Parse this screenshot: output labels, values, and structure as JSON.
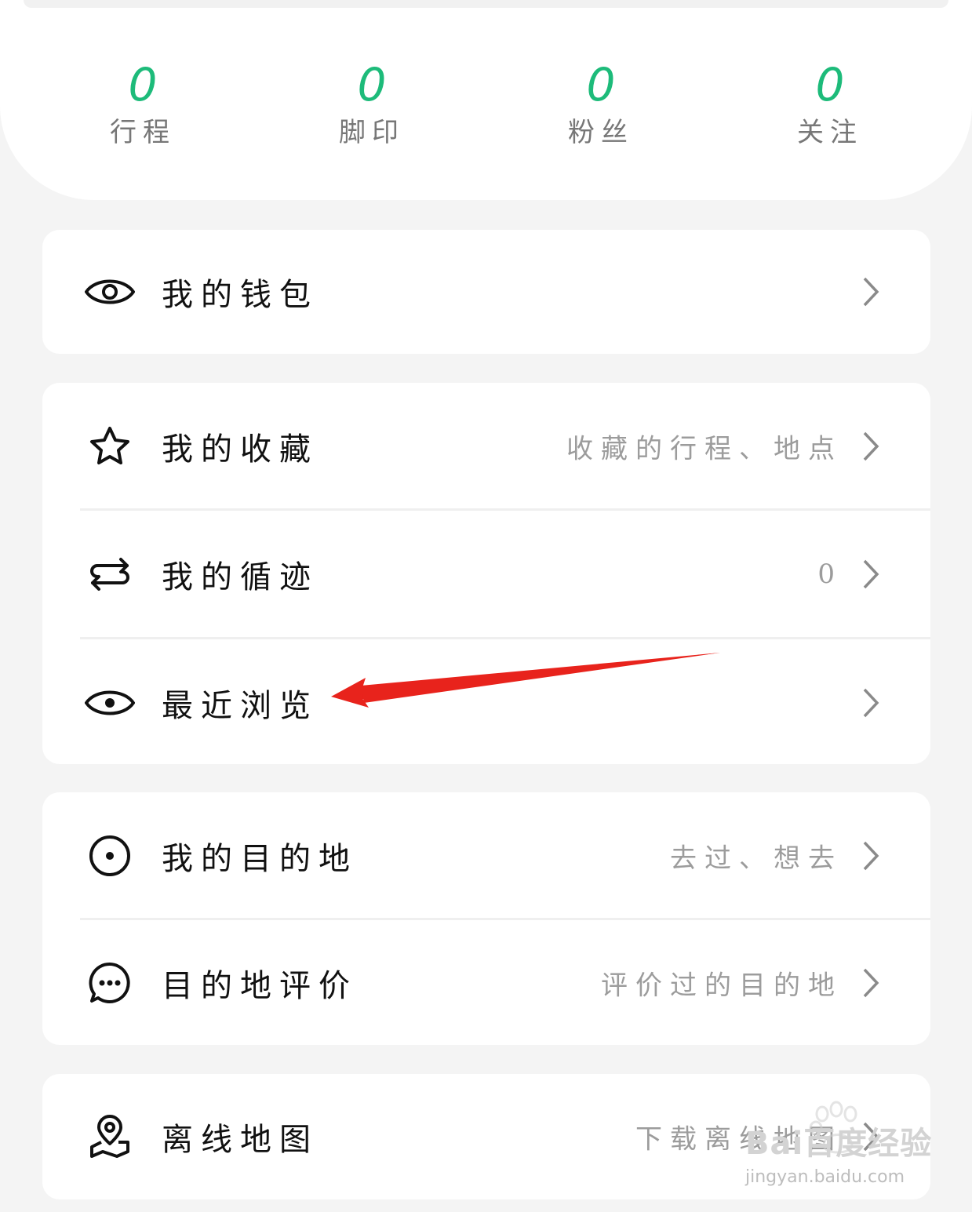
{
  "stats": [
    {
      "value": "0",
      "label": "行程"
    },
    {
      "value": "0",
      "label": "脚印"
    },
    {
      "value": "0",
      "label": "粉丝"
    },
    {
      "value": "0",
      "label": "关注"
    }
  ],
  "menu": {
    "wallet": {
      "label": "我的钱包",
      "icon": "eye-icon"
    },
    "favorites": {
      "label": "我的收藏",
      "hint": "收藏的行程、地点",
      "icon": "star-icon"
    },
    "tracks": {
      "label": "我的循迹",
      "hint": "0",
      "icon": "swap-arrows-icon"
    },
    "recent": {
      "label": "最近浏览",
      "icon": "eye-icon"
    },
    "destinations": {
      "label": "我的目的地",
      "hint": "去过、想去",
      "icon": "target-icon"
    },
    "reviews": {
      "label": "目的地评价",
      "hint": "评价过的目的地",
      "icon": "chat-bubble-icon"
    },
    "offline_map": {
      "label": "离线地图",
      "hint": "下载离线地图",
      "icon": "map-pin-icon"
    }
  },
  "watermark": {
    "brand": "Bai百度经验",
    "url": "jingyan.baidu.com"
  },
  "colors": {
    "accent": "#1dbb7a",
    "annotation_arrow": "#e8231c"
  }
}
